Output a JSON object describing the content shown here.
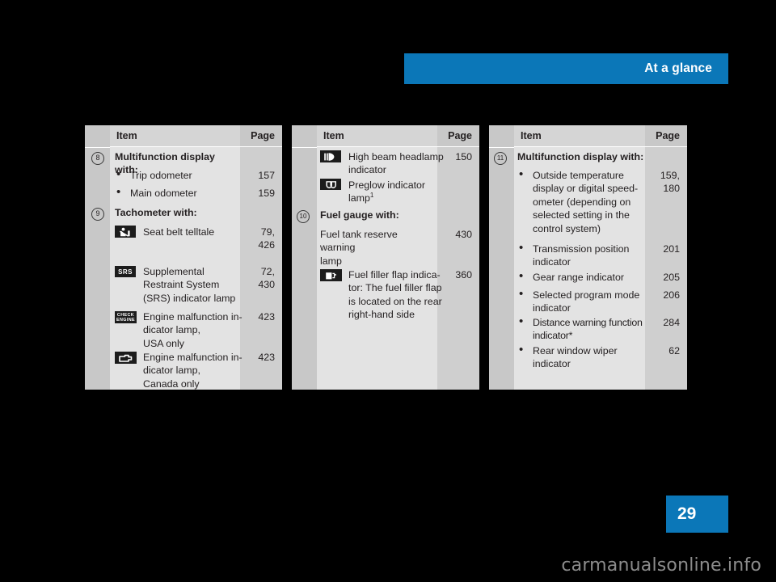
{
  "header": {
    "title": "At a glance",
    "bar_color": "#0b77b8"
  },
  "page": {
    "number": "29",
    "badge_color": "#0b77b8"
  },
  "watermark": {
    "text": "carmanualsonline.info"
  },
  "tables": [
    {
      "id": "table-1",
      "headers": {
        "item": "Item",
        "page": "Page"
      },
      "entries": [
        {
          "kind": "section",
          "marker": "8",
          "label": "Multifunction display with:",
          "page": ""
        },
        {
          "kind": "bullet",
          "label": "Trip odometer",
          "page": "157"
        },
        {
          "kind": "bullet",
          "label": "Main odometer",
          "page": "159"
        },
        {
          "kind": "section",
          "marker": "9",
          "label": "Tachometer with:",
          "page": ""
        },
        {
          "kind": "icon",
          "icon": "seat-belt-telltale-icon",
          "label": "Seat belt telltale",
          "page": "79,\n426"
        },
        {
          "kind": "icon",
          "icon": "srs-indicator-icon",
          "label": "Supplemental\nRestraint System\n(SRS) indicator lamp",
          "page": "72,\n430"
        },
        {
          "kind": "icon",
          "icon": "check-engine-icon",
          "label": "Engine malfunction in-\ndicator lamp,\nUSA only",
          "page": "423"
        },
        {
          "kind": "icon",
          "icon": "engine-outline-icon",
          "label": "Engine malfunction in-\ndicator lamp,\nCanada only",
          "page": "423"
        }
      ]
    },
    {
      "id": "table-2",
      "headers": {
        "item": "Item",
        "page": "Page"
      },
      "entries": [
        {
          "kind": "icon",
          "icon": "high-beam-headlamp-icon",
          "label": "High beam headlamp\nindicator",
          "page": "150"
        },
        {
          "kind": "icon",
          "icon": "preglow-indicator-icon",
          "label": "Preglow indicator\nlamp",
          "footnote": "1",
          "page": ""
        },
        {
          "kind": "section",
          "marker": "10",
          "label": "Fuel gauge with:",
          "page": ""
        },
        {
          "kind": "plain",
          "label": "Fuel tank reserve warning\nlamp",
          "page": "430"
        },
        {
          "kind": "icon",
          "icon": "fuel-filler-flap-icon",
          "label": "Fuel filler flap indica-\ntor: The fuel filler flap\nis located on the rear\nright-hand side",
          "page": "360"
        }
      ]
    },
    {
      "id": "table-3",
      "headers": {
        "item": "Item",
        "page": "Page"
      },
      "entries": [
        {
          "kind": "section",
          "marker": "11",
          "label": "Multifunction display with:",
          "page": ""
        },
        {
          "kind": "bullet",
          "label": "Outside temperature\ndisplay or digital speed-\nometer (depending on\nselected setting in the\ncontrol system)",
          "page": "159,\n180"
        },
        {
          "kind": "bullet",
          "label": "Transmission position\nindicator",
          "page": "201"
        },
        {
          "kind": "bullet",
          "label": "Gear range indicator",
          "page": "205"
        },
        {
          "kind": "bullet",
          "label": "Selected program mode\nindicator",
          "page": "206"
        },
        {
          "kind": "bullet",
          "label": "Distance warning function\nindicator*",
          "page": "284"
        },
        {
          "kind": "bullet",
          "label": "Rear window wiper\nindicator",
          "page": "62"
        }
      ]
    }
  ]
}
